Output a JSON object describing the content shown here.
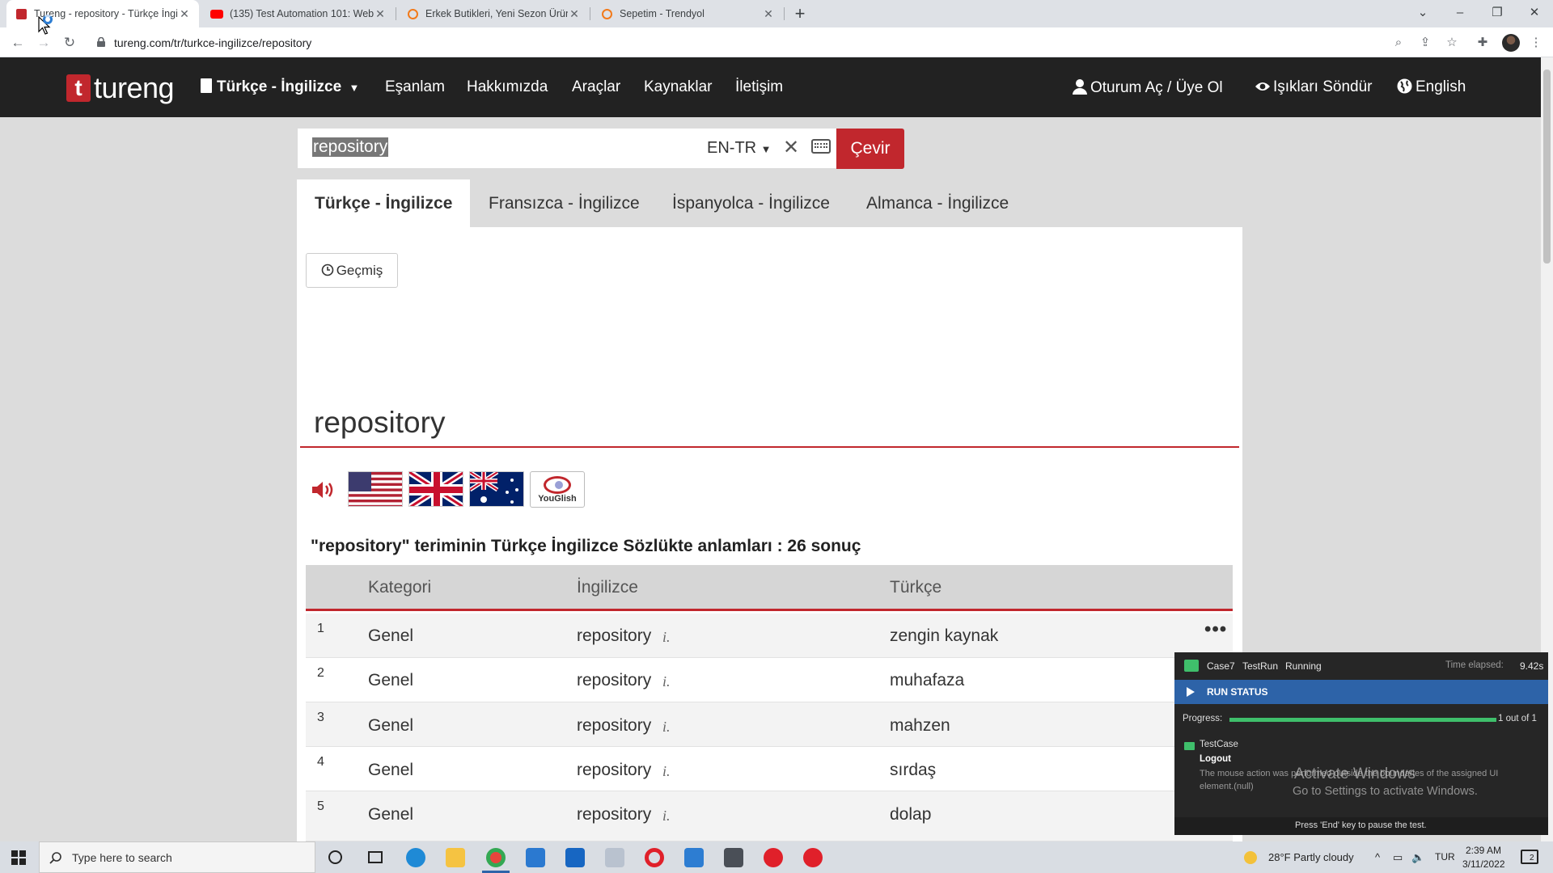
{
  "browser": {
    "tabs": [
      {
        "title": "Tureng - repository - Türkçe İngi",
        "active": true
      },
      {
        "title": "(135) Test Automation 101: Web",
        "active": false
      },
      {
        "title": "Erkek Butikleri, Yeni Sezon Ürünle",
        "active": false
      },
      {
        "title": "Sepetim - Trendyol",
        "active": false
      }
    ],
    "new_tab": "+",
    "url": "tureng.com/tr/turkce-ingilizce/repository"
  },
  "site": {
    "logo_mark": "t",
    "logo_text": "tureng",
    "nav": {
      "dictionary": "Türkçe - İngilizce",
      "synonyms": "Eşanlam",
      "about": "Hakkımızda",
      "tools": "Araçlar",
      "resources": "Kaynaklar",
      "contact": "İletişim",
      "login": "Oturum Aç / Üye Ol",
      "lights": "Işıkları Söndür",
      "language": "English"
    },
    "search": {
      "value": "repository",
      "lang": "EN-TR",
      "button": "Çevir"
    },
    "lang_tabs": [
      "Türkçe - İngilizce",
      "Fransızca - İngilizce",
      "İspanyolca - İngilizce",
      "Almanca - İngilizce"
    ],
    "history_button": "Geçmiş",
    "headword": "repository",
    "youglish": "YouGlish",
    "results_title": "\"repository\" teriminin Türkçe İngilizce Sözlükte anlamları : 26 sonuç",
    "table": {
      "headers": [
        "Kategori",
        "İngilizce",
        "Türkçe"
      ],
      "rows": [
        {
          "n": "1",
          "category": "Genel",
          "english": "repository",
          "tag": "i.",
          "turkish": "zengin kaynak"
        },
        {
          "n": "2",
          "category": "Genel",
          "english": "repository",
          "tag": "i.",
          "turkish": "muhafaza"
        },
        {
          "n": "3",
          "category": "Genel",
          "english": "repository",
          "tag": "i.",
          "turkish": "mahzen"
        },
        {
          "n": "4",
          "category": "Genel",
          "english": "repository",
          "tag": "i.",
          "turkish": "sırdaş"
        },
        {
          "n": "5",
          "category": "Genel",
          "english": "repository",
          "tag": "i.",
          "turkish": "dolap"
        }
      ]
    }
  },
  "runner": {
    "case": "Case7",
    "run": "TestRun",
    "state": "Running",
    "elapsed_label": "Time elapsed:",
    "elapsed_value": "9.42s",
    "status_title": "RUN STATUS",
    "progress_label": "Progress:",
    "progress_fraction": 1.0,
    "progress_text": "1 out of 1",
    "item_type": "TestCase",
    "item_name": "Logout",
    "message_line1": "The mouse action was performed outside the boundaries of the assigned UI",
    "message_line2": "element.(null)",
    "footer": "Press 'End' key to pause the test."
  },
  "watermark": {
    "line1": "Activate Windows",
    "line2": "Go to Settings to activate Windows."
  },
  "taskbar": {
    "search_placeholder": "Type here to search",
    "weather": "28°F  Partly cloudy",
    "lang": "TUR",
    "time": "2:39 AM",
    "date": "3/11/2022",
    "notifications": "2"
  },
  "colors": {
    "brand_red": "#c1272d",
    "header_bg": "#222222",
    "page_bg": "#dcdcdc",
    "run_blue": "#2d63a8",
    "progress_green": "#3fbf6b"
  }
}
